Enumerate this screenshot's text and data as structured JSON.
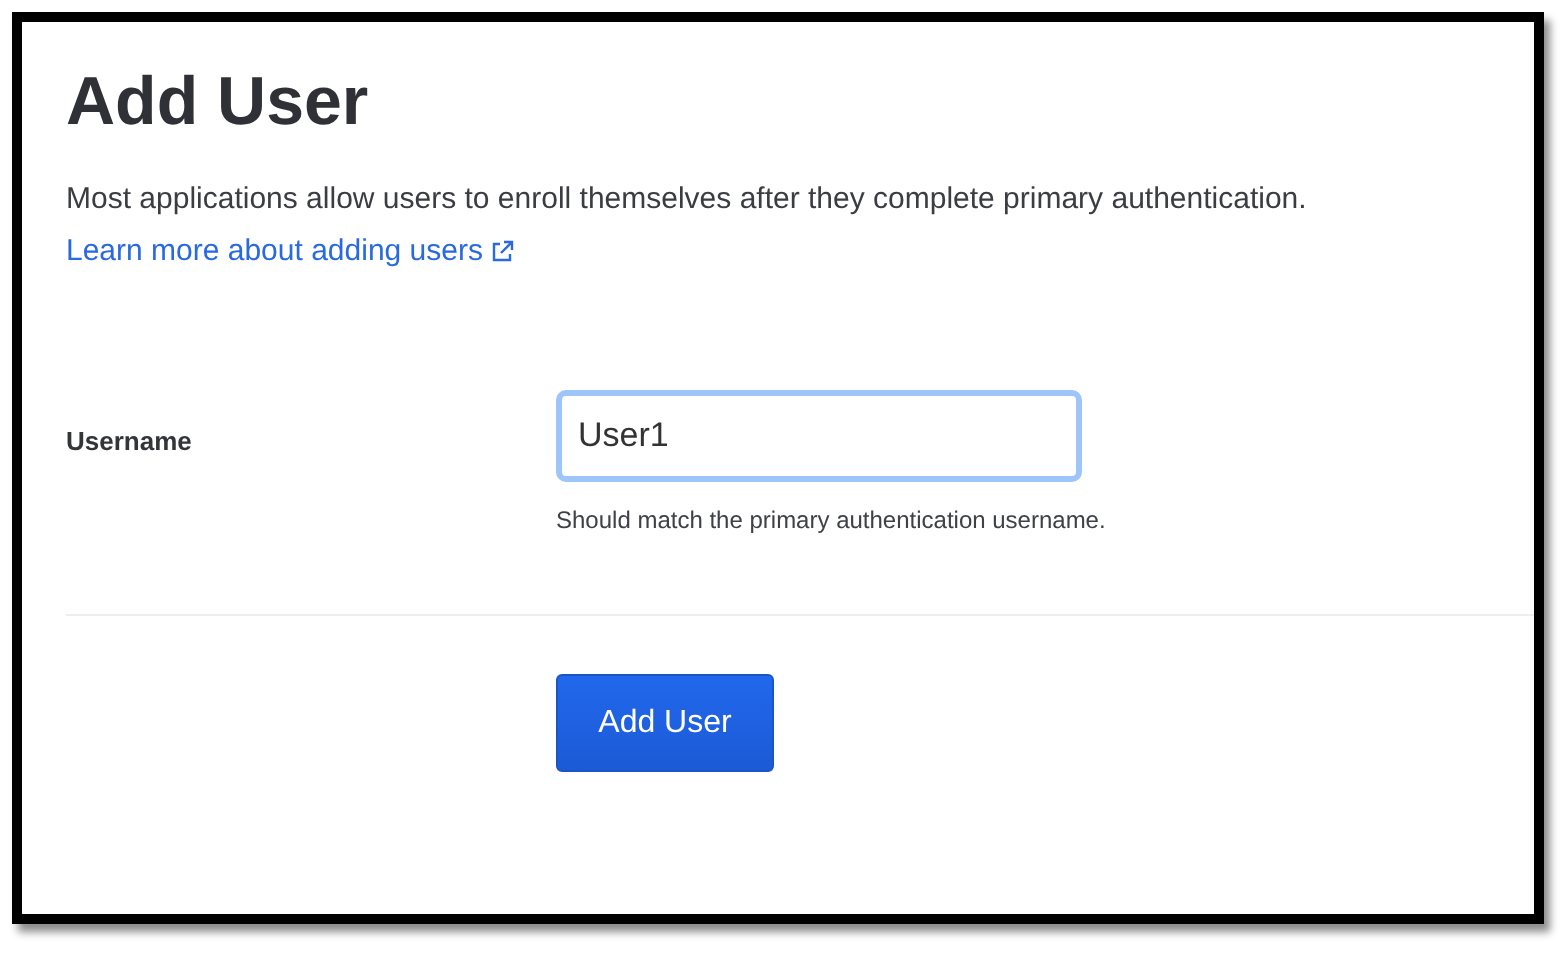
{
  "title": "Add User",
  "description": "Most applications allow users to enroll themselves after they complete primary authentication.",
  "link": {
    "label": "Learn more about adding users"
  },
  "form": {
    "label": "Username",
    "value": "User1",
    "focused": true,
    "hint": "Should match the primary authentication username."
  },
  "button": {
    "label": "Add User"
  }
}
